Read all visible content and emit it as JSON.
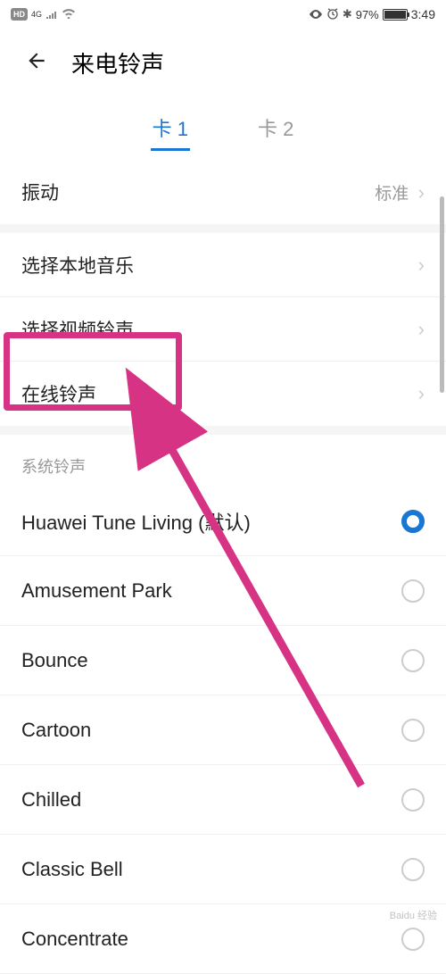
{
  "status_bar": {
    "hd": "HD",
    "network": "4G",
    "battery_pct": "97%",
    "time": "3:49"
  },
  "header": {
    "title": "来电铃声"
  },
  "tabs": {
    "sim1": "卡 1",
    "sim2": "卡 2",
    "active": 0
  },
  "vibration": {
    "label": "振动",
    "value": "标准"
  },
  "music_sources": {
    "local": "选择本地音乐",
    "video": "选择视频铃声",
    "online": "在线铃声"
  },
  "system_section": {
    "header": "系统铃声"
  },
  "ringtones": [
    {
      "name": "Huawei Tune Living (默认)",
      "selected": true
    },
    {
      "name": "Amusement Park",
      "selected": false
    },
    {
      "name": "Bounce",
      "selected": false
    },
    {
      "name": "Cartoon",
      "selected": false
    },
    {
      "name": "Chilled",
      "selected": false
    },
    {
      "name": "Classic Bell",
      "selected": false
    },
    {
      "name": "Concentrate",
      "selected": false
    }
  ],
  "annotation": {
    "highlight_color": "#d63384"
  },
  "watermark": "Baidu 经验"
}
